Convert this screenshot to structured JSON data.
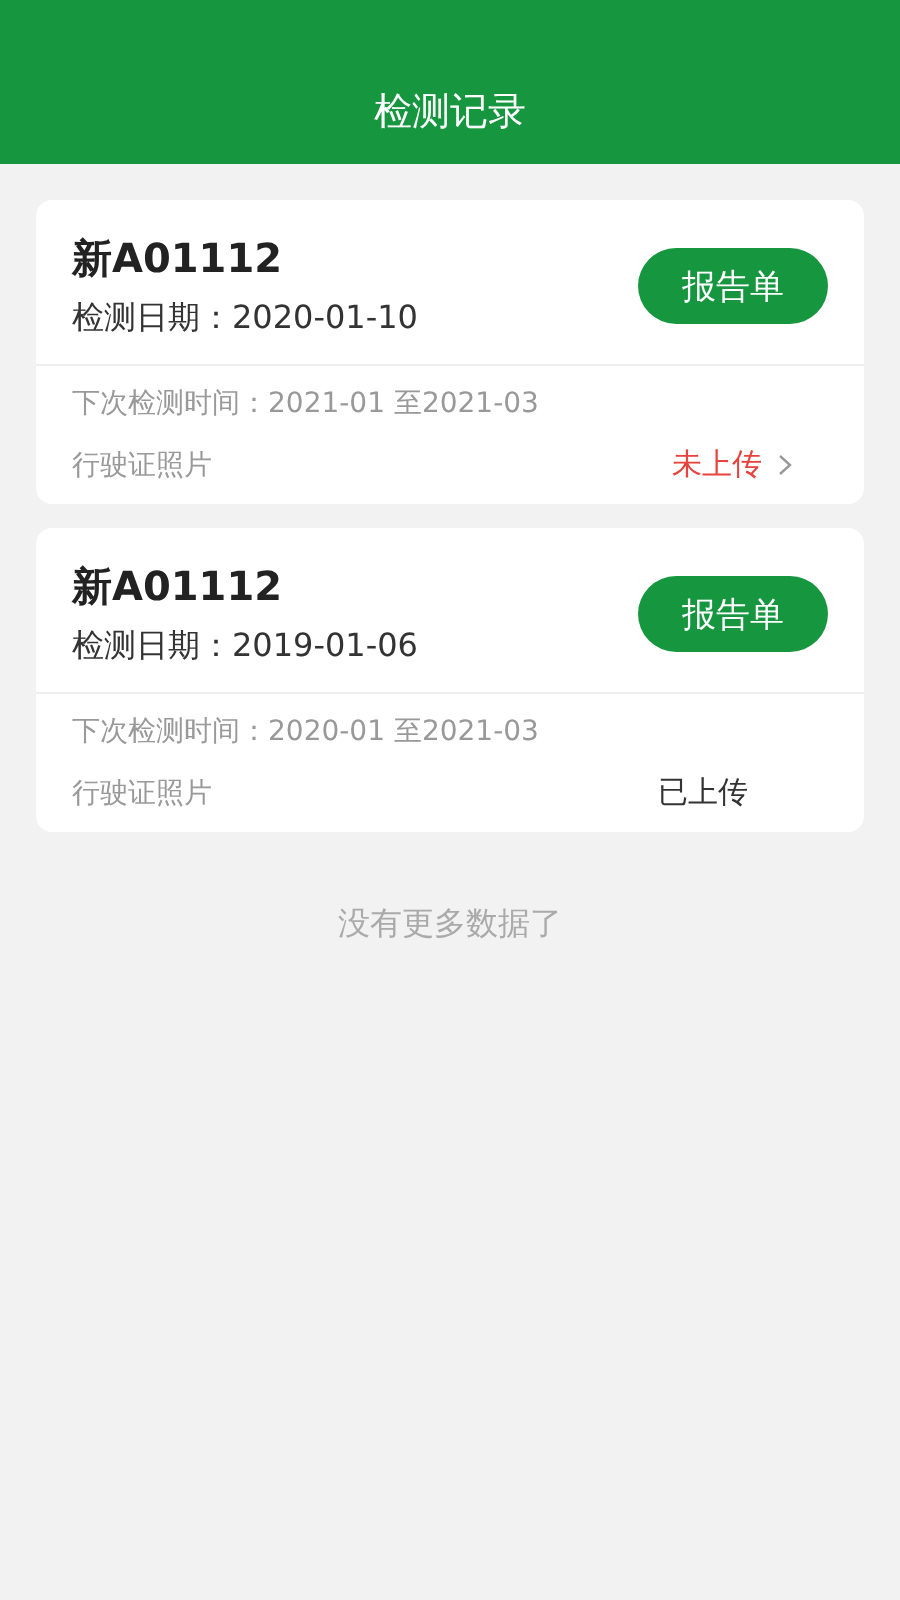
{
  "header": {
    "title": "检测记录"
  },
  "records": [
    {
      "plate": "新A01112",
      "date_label": "检测日期：",
      "date": "2020-01-10",
      "report_button": "报告单",
      "next_check": "下次检测时间：2021-01 至2021-03",
      "license_label": "行驶证照片",
      "upload_status": "未上传",
      "uploaded": false
    },
    {
      "plate": "新A01112",
      "date_label": "检测日期：",
      "date": "2019-01-06",
      "report_button": "报告单",
      "next_check": "下次检测时间：2020-01 至2021-03",
      "license_label": "行驶证照片",
      "upload_status": "已上传",
      "uploaded": true
    }
  ],
  "footer_note": "没有更多数据了"
}
